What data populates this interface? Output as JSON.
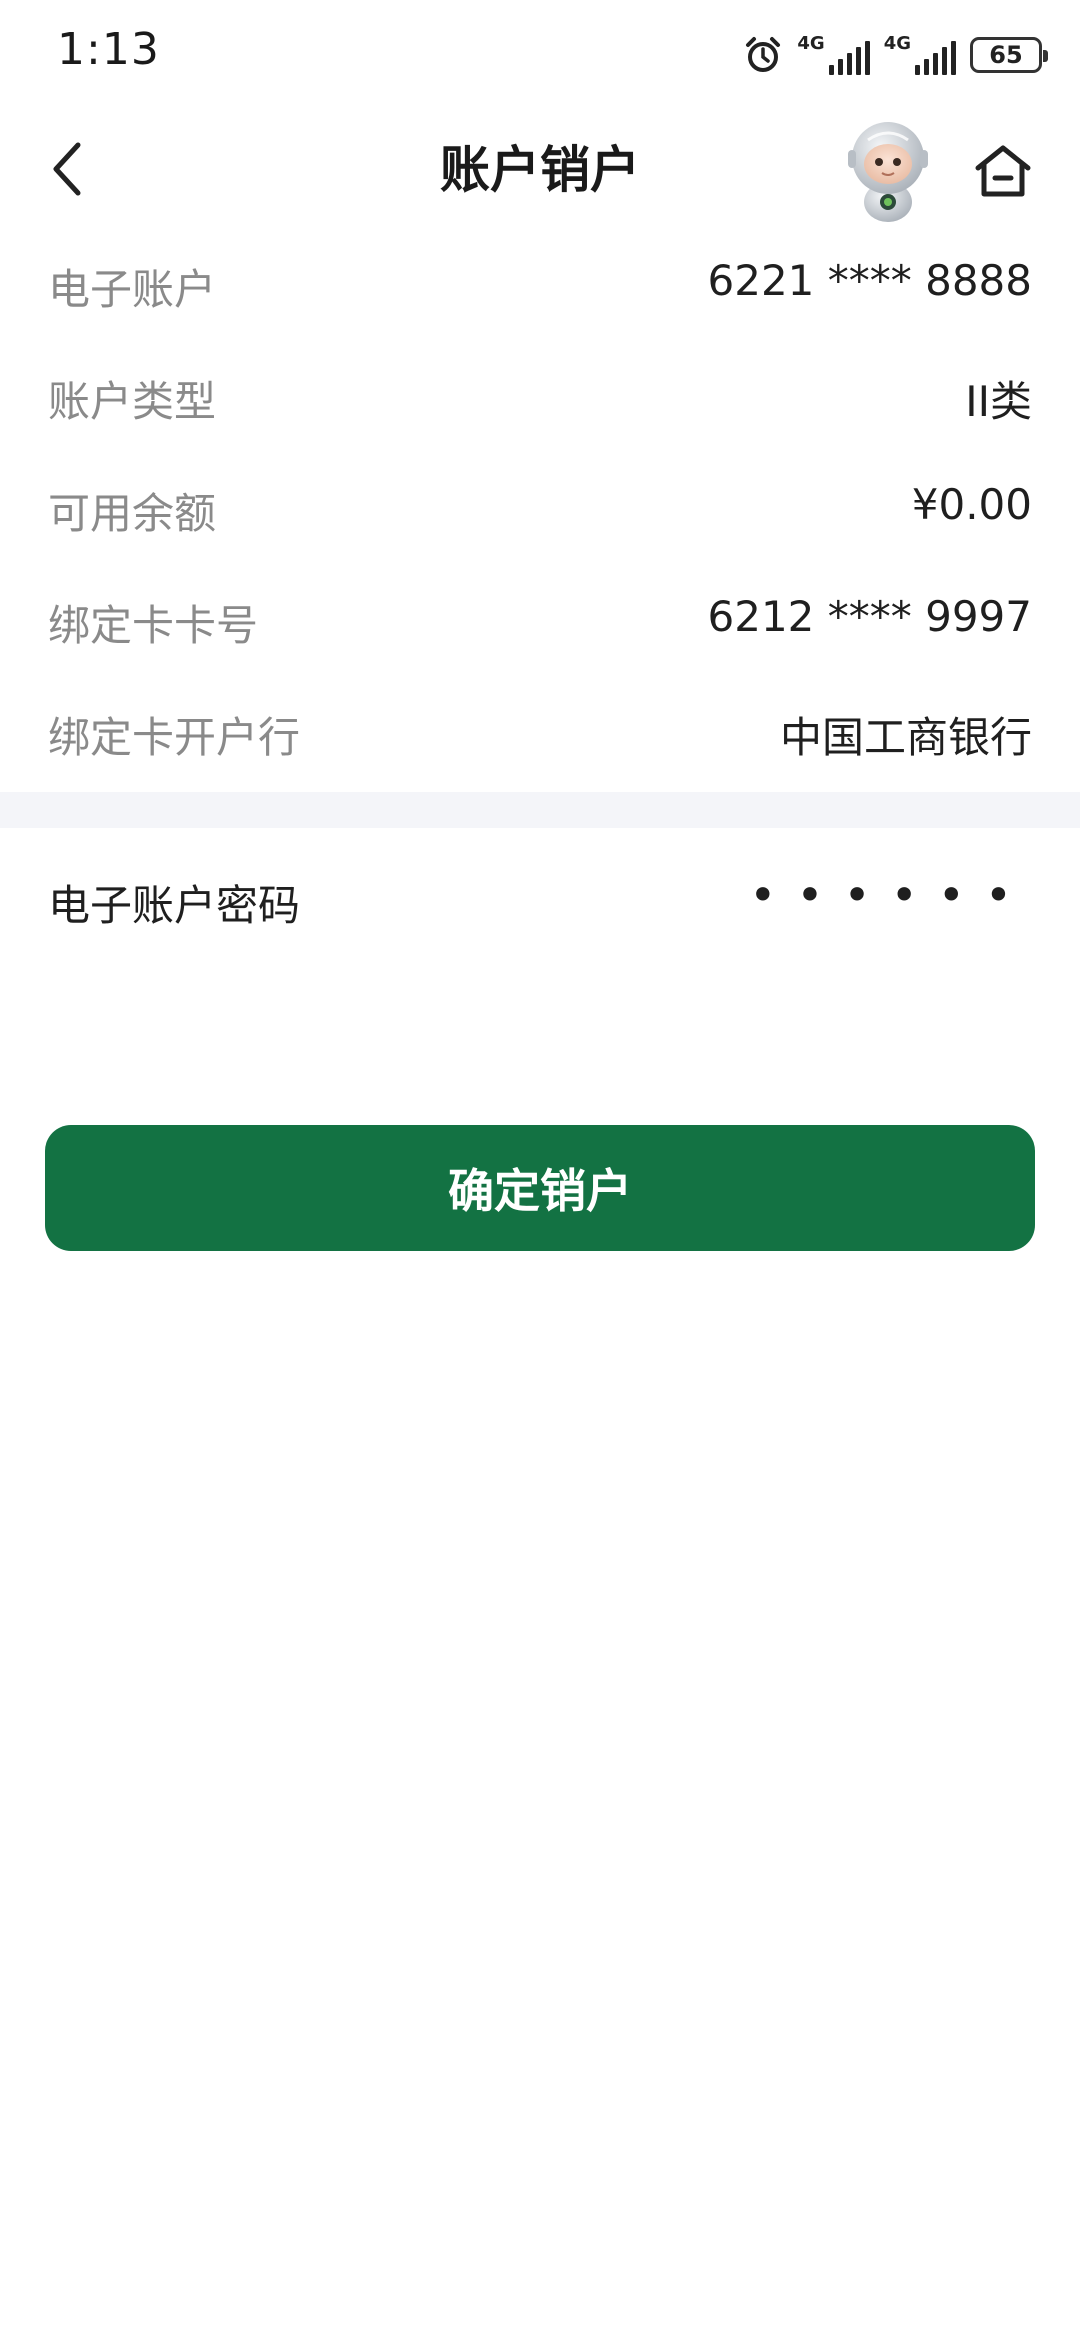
{
  "status_bar": {
    "time": "1:13",
    "network_1": "4G",
    "network_2": "4G",
    "battery": "65"
  },
  "nav": {
    "title": "账户销户",
    "icons": [
      "back-arrow-icon",
      "mascot-robot-icon",
      "home-icon"
    ]
  },
  "account_info": [
    {
      "label": "电子账户",
      "value": "6221 **** 8888"
    },
    {
      "label": "账户类型",
      "value": "II类"
    },
    {
      "label": "可用余额",
      "value": "¥0.00"
    },
    {
      "label": "绑定卡卡号",
      "value": "6212 **** 9997"
    },
    {
      "label": "绑定卡开户行",
      "value": "中国工商银行"
    }
  ],
  "password": {
    "label": "电子账户密码",
    "masked_value": "••••••"
  },
  "actions": {
    "confirm_label": "确定销户"
  },
  "colors": {
    "primary_green": "#137243",
    "label_gray": "#8a8a8a",
    "section_bg": "#f4f5f9"
  }
}
